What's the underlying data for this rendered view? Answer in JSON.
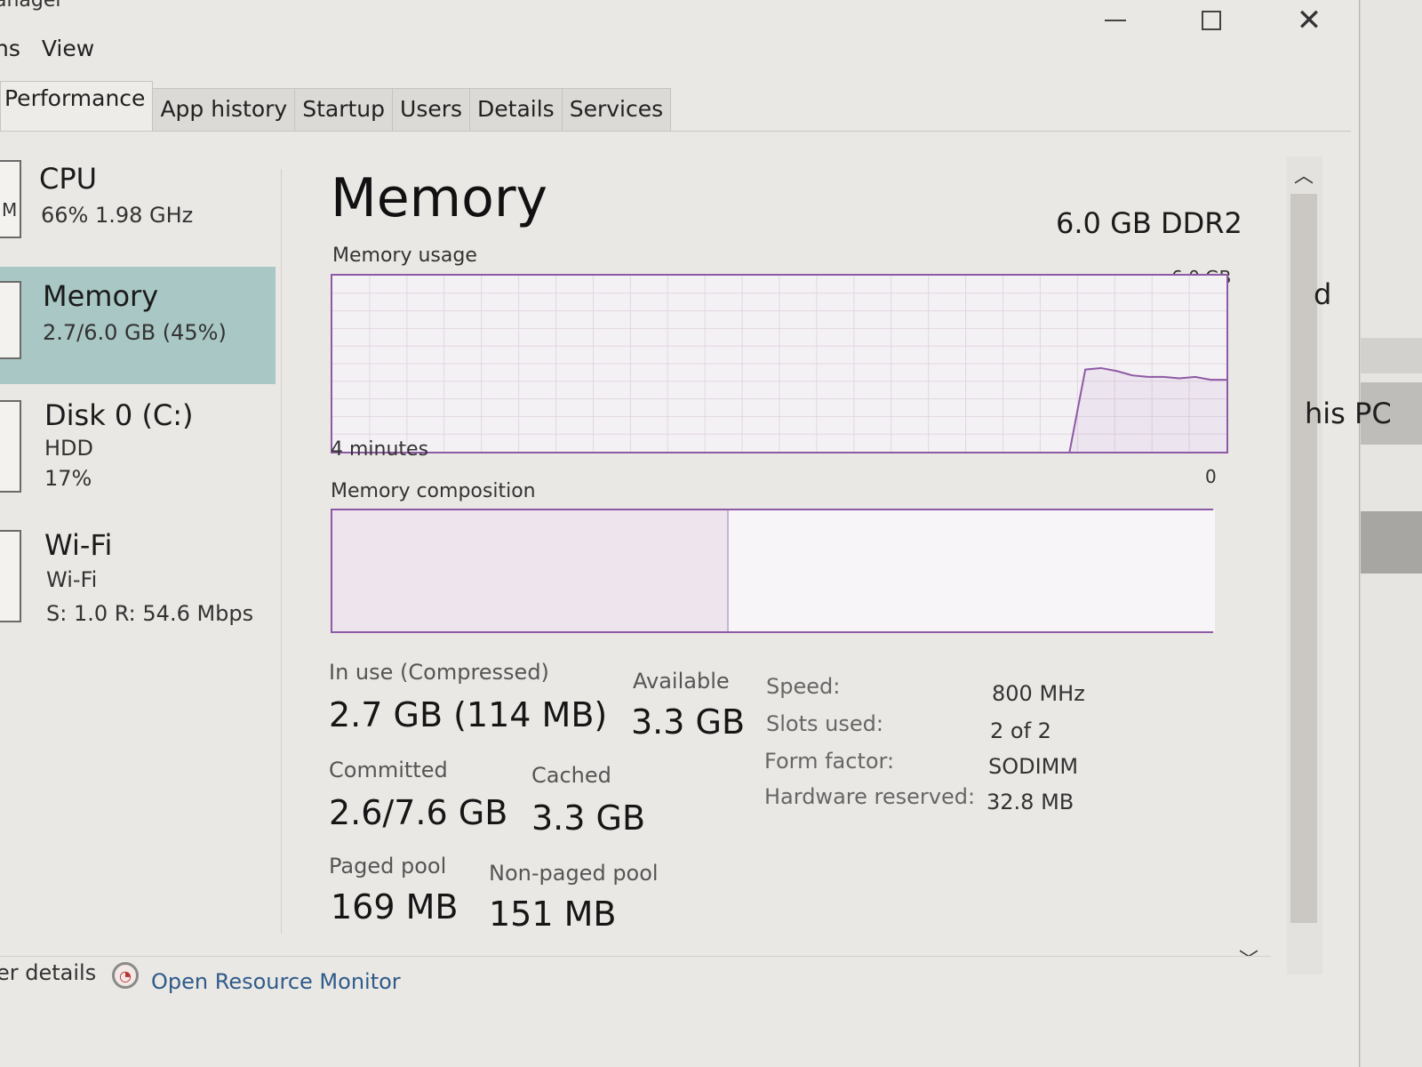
{
  "window": {
    "title": "anager"
  },
  "menu": {
    "items": [
      "ns",
      "View"
    ]
  },
  "tabs": [
    "Performance",
    "App history",
    "Startup",
    "Users",
    "Details",
    "Services"
  ],
  "sidebar": {
    "items": [
      {
        "name": "CPU",
        "line1": "66%  1.98 GHz",
        "line2": ""
      },
      {
        "name": "Memory",
        "line1": "2.7/6.0 GB (45%)",
        "line2": ""
      },
      {
        "name": "Disk 0 (C:)",
        "line1": "HDD",
        "line2": "17%"
      },
      {
        "name": "Wi-Fi",
        "line1": "Wi-Fi",
        "line2": "S: 1.0  R: 54.6 Mbps"
      }
    ],
    "cpu_thumb_letter": "M"
  },
  "main": {
    "title": "Memory",
    "spec": "6.0 GB DDR2",
    "usage_label": "Memory usage",
    "usage_max": "6.0 GB",
    "usage_time": "4 minutes",
    "usage_min": "0",
    "composition_label": "Memory composition"
  },
  "stats": {
    "in_use_label": "In use (Compressed)",
    "in_use_value": "2.7 GB (114 MB)",
    "available_label": "Available",
    "available_value": "3.3 GB",
    "committed_label": "Committed",
    "committed_value": "2.6/7.6 GB",
    "cached_label": "Cached",
    "cached_value": "3.3 GB",
    "paged_label": "Paged pool",
    "paged_value": "169 MB",
    "nonpaged_label": "Non-paged pool",
    "nonpaged_value": "151 MB"
  },
  "specs": {
    "speed_label": "Speed:",
    "speed_value": "800 MHz",
    "slots_label": "Slots used:",
    "slots_value": "2 of 2",
    "form_label": "Form factor:",
    "form_value": "SODIMM",
    "hw_label": "Hardware reserved:",
    "hw_value": "32.8 MB"
  },
  "footer": {
    "fewer_details": "er details",
    "resource_monitor": "Open Resource Monitor"
  },
  "background": {
    "text1": "d",
    "text2": "his PC"
  },
  "colors": {
    "accent": "#8d5aa5",
    "selected": "#a9c7c4"
  },
  "chart_data": {
    "type": "line",
    "title": "Memory usage",
    "y_max_label": "6.0 GB",
    "y_min_label": "0",
    "x_label": "4 minutes",
    "series": [
      {
        "values": [
          0,
          0,
          0,
          0,
          0,
          0,
          0,
          0,
          0,
          0,
          0,
          0,
          0,
          0,
          0,
          0,
          0,
          0,
          0,
          0,
          0,
          0,
          0,
          0,
          0,
          0,
          0,
          0,
          0,
          0,
          0,
          0,
          0,
          0,
          0,
          0,
          0,
          0,
          0,
          0,
          0,
          0,
          0,
          0,
          0,
          0,
          0,
          0,
          2.8,
          2.85,
          2.75,
          2.6,
          2.55,
          2.55,
          2.5,
          2.55,
          2.45,
          2.45
        ]
      }
    ],
    "grid": true,
    "ylim": [
      0,
      6
    ]
  }
}
